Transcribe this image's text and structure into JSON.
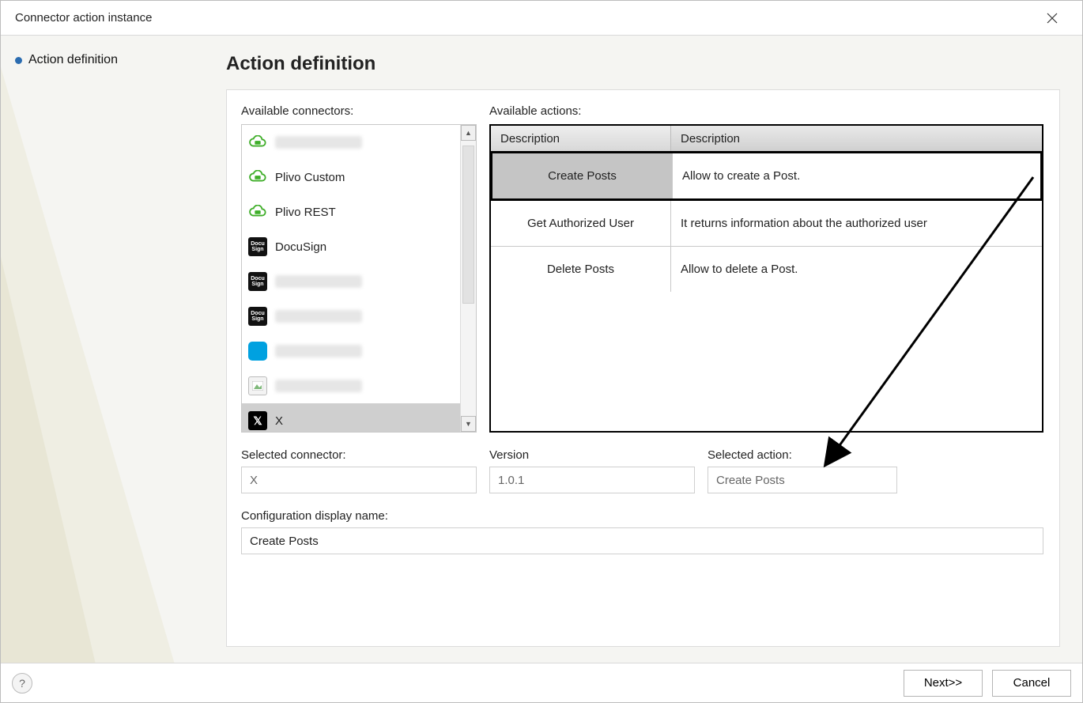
{
  "window": {
    "title": "Connector action instance"
  },
  "nav": {
    "active_item": "Action definition"
  },
  "heading": "Action definition",
  "labels": {
    "available_connectors": "Available connectors:",
    "available_actions": "Available actions:",
    "selected_connector": "Selected connector:",
    "version": "Version",
    "selected_action": "Selected action:",
    "config_display_name": "Configuration display name:"
  },
  "connectors": [
    {
      "name": "",
      "icon": "cloud",
      "blurred": true
    },
    {
      "name": "Plivo Custom",
      "icon": "cloud"
    },
    {
      "name": "Plivo REST",
      "icon": "cloud"
    },
    {
      "name": "DocuSign",
      "icon": "docusign"
    },
    {
      "name": "",
      "icon": "docusign",
      "blurred": true
    },
    {
      "name": "",
      "icon": "docusign",
      "blurred": true
    },
    {
      "name": "",
      "icon": "salesforce",
      "blurred": true
    },
    {
      "name": "",
      "icon": "image",
      "blurred": true
    },
    {
      "name": "X",
      "icon": "x",
      "selected": true
    }
  ],
  "actions_table": {
    "headers": [
      "Description",
      "Description"
    ],
    "rows": [
      {
        "name": "Create Posts",
        "desc": "Allow to create a Post.",
        "selected": true
      },
      {
        "name": "Get Authorized User",
        "desc": "It returns information about the authorized user"
      },
      {
        "name": "Delete Posts",
        "desc": "Allow to delete a Post."
      }
    ]
  },
  "fields": {
    "selected_connector": "X",
    "version": "1.0.1",
    "selected_action": "Create Posts",
    "config_display_name": "Create Posts"
  },
  "footer": {
    "next": "Next>>",
    "cancel": "Cancel"
  }
}
